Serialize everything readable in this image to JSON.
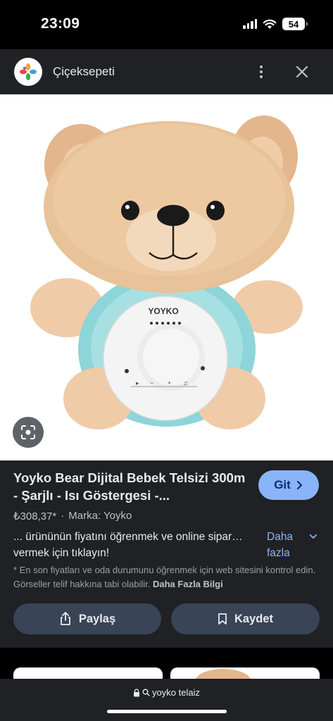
{
  "status_bar": {
    "time": "23:09",
    "battery": "54"
  },
  "header": {
    "site_name": "Çiçeksepeti"
  },
  "product": {
    "title": "Yoyko Bear Dijital Bebek Telsizi 300m - Şarjlı - Isı Göstergesi -...",
    "go_label": "Git",
    "price": "₺308,37*",
    "separator": "·",
    "brand": "Marka: Yoyko",
    "description": "... ürününün fiyatını öğrenmek ve online sipar… vermek için tıklayın!",
    "more_label": "Daha fazla",
    "disclaimer": "* En son fiyatları ve oda durumunu öğrenmek için web sitesini kontrol edin. Görseller telif hakkına tabi olabilir.",
    "disclaimer_link": "Daha Fazla Bilgi",
    "device_brand": "YOYKO"
  },
  "actions": {
    "share_label": "Paylaş",
    "save_label": "Kaydet"
  },
  "address_bar": {
    "query": "yoyko telaiz"
  },
  "colors": {
    "accent": "#8ab4f8",
    "panel": "#202124",
    "pill": "#394457"
  },
  "icons": [
    "flower-logo-icon",
    "more-vert-icon",
    "close-icon",
    "lens-icon",
    "chevron-right-icon",
    "chevron-down-icon",
    "share-icon",
    "bookmark-icon",
    "lock-icon",
    "search-icon"
  ]
}
